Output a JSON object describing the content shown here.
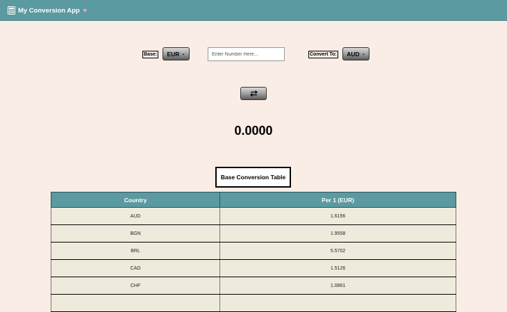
{
  "app": {
    "title": "My Conversion App",
    "heart": "♥",
    "icon": "calculator-icon"
  },
  "controls": {
    "base_label": "Base:",
    "base_currency": "EUR",
    "amount_placeholder": "Enter Number Here...",
    "convert_label": "Convert To:",
    "target_currency": "AUD",
    "swap_icon": "swap-arrows-icon"
  },
  "result": "0.0000",
  "table": {
    "title": "Base Conversion Table",
    "headers": [
      "Country",
      "Per 1 (EUR)"
    ],
    "rows": [
      {
        "country": "AUD",
        "rate": "1.6156"
      },
      {
        "country": "BGN",
        "rate": "1.9558"
      },
      {
        "country": "BRL",
        "rate": "5.5702"
      },
      {
        "country": "CAD",
        "rate": "1.5126"
      },
      {
        "country": "CHF",
        "rate": "1.0861"
      },
      {
        "country": "",
        "rate": ""
      }
    ]
  },
  "colors": {
    "navbar": "#5a9aa0",
    "background": "#f9ede6",
    "table_row": "#efebdc"
  }
}
